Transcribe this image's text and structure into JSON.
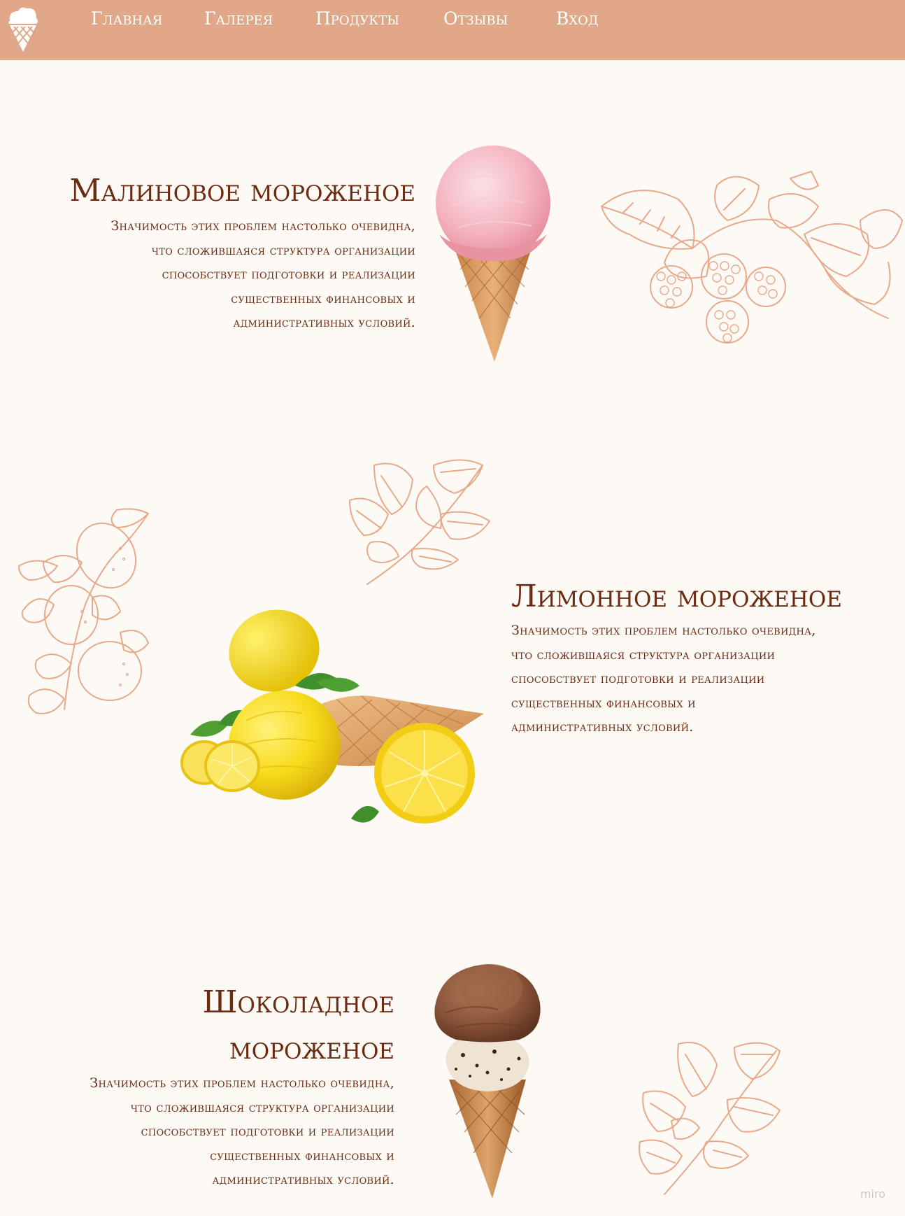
{
  "nav": {
    "items": [
      "Главная",
      "Галерея",
      "Продукты",
      "Отзывы",
      "Вход"
    ],
    "logo_icon": "ice-cream-cone-icon"
  },
  "products": [
    {
      "title_lines": [
        "Малиновое мороженое"
      ],
      "description_lines": [
        "Значимость этих проблем настолько очевидна,",
        "что сложившаяся структура организации",
        "способствует подготовки и реализации",
        "существенных финансовых и",
        "административных условий."
      ],
      "image_icon": "raspberry-ice-cream-cone",
      "decoration_icon": "raspberry-branch-sketch"
    },
    {
      "title_lines": [
        "Лимонное мороженое"
      ],
      "description_lines": [
        "Значимость этих проблем настолько очевидна,",
        "что сложившаяся структура организации",
        "способствует подготовки и реализации",
        "существенных финансовых и",
        "административных условий."
      ],
      "image_icon": "lemon-ice-cream-cone",
      "decoration_icon": "lemon-branch-sketch"
    },
    {
      "title_lines": [
        "Шоколадное",
        "мороженое"
      ],
      "description_lines": [
        "Значимость этих проблем настолько очевидна,",
        "что сложившаяся структура организации",
        "способствует подготовки и реализации",
        "существенных финансовых и",
        "административных условий."
      ],
      "image_icon": "chocolate-ice-cream-cone",
      "decoration_icon": "leaf-branch-sketch"
    }
  ],
  "watermark": "miro",
  "colors": {
    "navbar": "#e0a888",
    "page_background": "#fdfaf6",
    "heading_text": "#6b2a12",
    "sketch_stroke": "#e8a98a"
  }
}
